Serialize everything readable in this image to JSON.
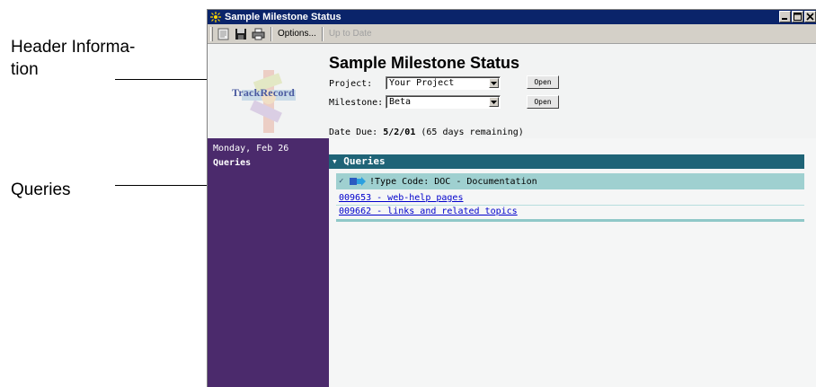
{
  "callouts": {
    "header_line1": "Header Informa-",
    "header_line2": "tion",
    "queries": "Queries"
  },
  "window": {
    "title": "Sample Milestone Status",
    "controls": [
      "minimize-icon",
      "maximize-icon",
      "close-icon"
    ]
  },
  "toolbar": {
    "icons": [
      "document-icon",
      "save-icon",
      "print-icon"
    ],
    "options_label": "Options...",
    "uptodate_label": "Up to Date"
  },
  "header": {
    "logo_text": "TrackRecord",
    "title": "Sample Milestone Status",
    "project_label": "Project:",
    "project_value": "Your Project",
    "milestone_label": "Milestone:",
    "milestone_value": "Beta",
    "open_label": "Open",
    "date_due_label": "Date Due:",
    "date_due_value": "5/2/01",
    "date_due_note": "(65 days remaining)"
  },
  "sidebar": {
    "date": "Monday, Feb 26",
    "link": "Queries"
  },
  "queries": {
    "header": "Queries",
    "group_label": "!Type Code: DOC - Documentation",
    "items": [
      "009653 - web-help pages",
      "009662 - links and related topics"
    ]
  },
  "colors": {
    "titlebar": "#0a246a",
    "sidebar": "#4b2a6c",
    "queries_header": "#1f6477",
    "group_row": "#9fd0d0",
    "link": "#0000cc"
  }
}
